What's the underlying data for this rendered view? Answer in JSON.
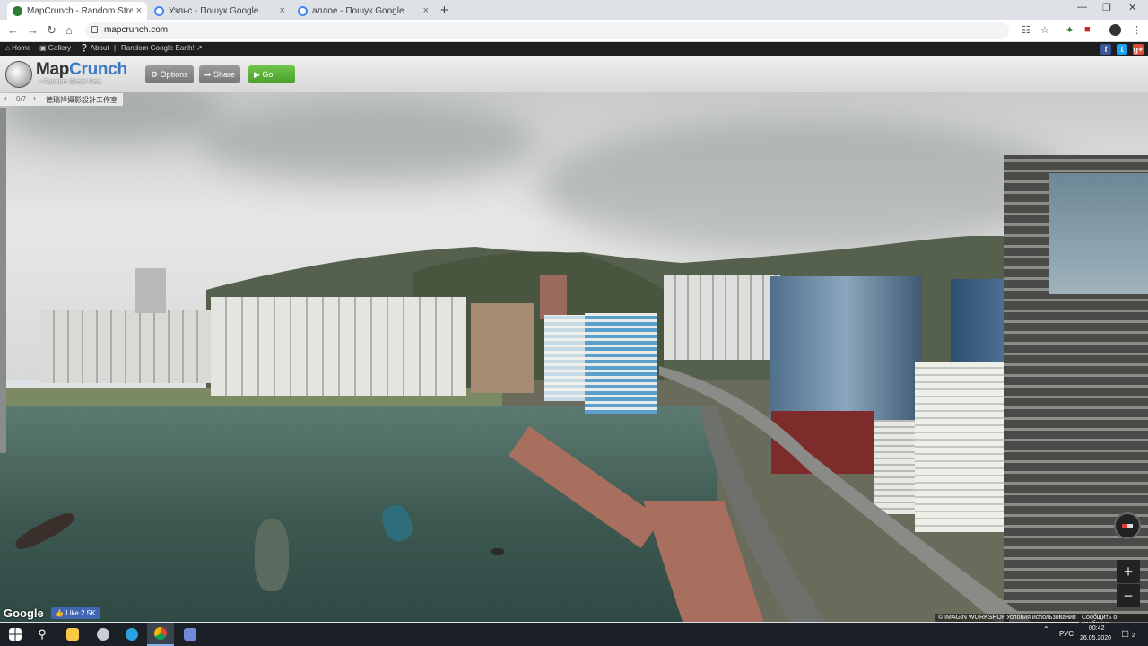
{
  "browser": {
    "tabs": [
      {
        "title": "MapCrunch - Random Street Vie",
        "active": true,
        "favicon_color": "#2e7d32"
      },
      {
        "title": "Узльс - Пошук Google",
        "active": false,
        "favicon_color": "#4285f4"
      },
      {
        "title": "аллое - Пошук Google",
        "active": false,
        "favicon_color": "#4285f4"
      }
    ],
    "url": "mapcrunch.com",
    "new_tab": "+",
    "close_glyph": "×"
  },
  "mapcrunch": {
    "nav": {
      "home": "Home",
      "gallery": "Gallery",
      "about": "About",
      "random_earth": "Random Google Earth!"
    },
    "logo": {
      "map": "Map",
      "crunch": "Crunch",
      "tagline": "» Random Street View"
    },
    "buttons": {
      "options": "Options",
      "share": "Share",
      "go": "Go!"
    },
    "location": {
      "prev": "‹",
      "counter": "0/7",
      "next": "›",
      "place": "德瑞祥攝影設計工作室"
    },
    "social": {
      "facebook": "f",
      "twitter": "t",
      "gplus": "g+"
    }
  },
  "streetview": {
    "google_logo": "Google",
    "like_label": "Like 2.5K",
    "imagery_credit": "© IMAGIN WORKSHOP",
    "terms": "Условия использования",
    "report": "Сообщить о проблеме",
    "zoom_in": "+",
    "zoom_out": "−"
  },
  "taskbar": {
    "lang": "РУС",
    "time": "00:42",
    "date": "26.05.2020",
    "notif_count": "2"
  },
  "colors": {
    "go_green": "#5cb23a",
    "logo_blue": "#3a79c4",
    "facebook": "#3b5998",
    "twitter": "#1da1f2",
    "gplus": "#dd4b39"
  }
}
